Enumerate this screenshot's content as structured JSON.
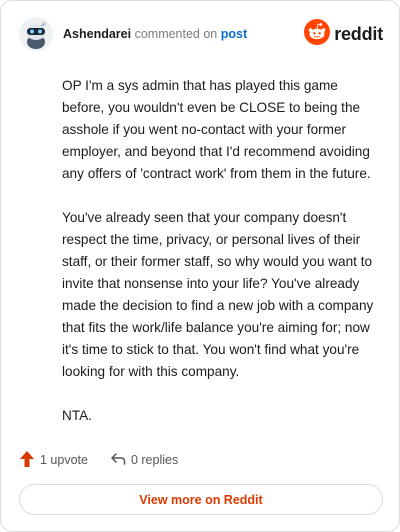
{
  "comment": {
    "author": "Ashendarei",
    "action_text": "commented on",
    "post_link": "post",
    "paragraphs": [
      "OP I'm a sys admin that has played this game before, you wouldn't even be CLOSE to being the asshole if you went no-contact with your former employer, and beyond that I'd recommend avoiding any offers of 'contract work' from them in the future.",
      "You've already seen that your company doesn't respect the time, privacy, or personal lives of their staff, or their former staff, so why would you want to invite that nonsense into your life? You've already made the decision to find a new job with a company that fits the work/life balance you're aiming for; now it's time to stick to that. You won't find what you're looking for with this company.",
      "NTA."
    ]
  },
  "branding": {
    "logo_text": "reddit",
    "brand_color": "#ff4500"
  },
  "actions": {
    "upvote_label": "1 upvote",
    "reply_label": "0 replies",
    "upvote_color": "#d93a00"
  },
  "footer": {
    "view_more_label": "View more on Reddit"
  },
  "icons": {
    "avatar": "snoo-avatar-icon",
    "logo": "reddit-snoo-icon",
    "upvote": "upvote-arrow-icon",
    "reply": "reply-arrow-icon"
  }
}
